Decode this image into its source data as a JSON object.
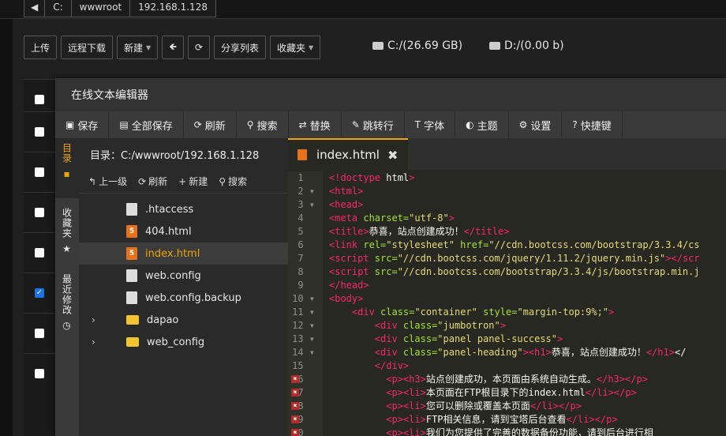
{
  "breadcrumb": [
    "C:",
    "wwwroot",
    "192.168.1.128"
  ],
  "toolbar": {
    "upload": "上传",
    "remote_download": "远程下载",
    "new": "新建",
    "share_list": "分享列表",
    "favorites": "收藏夹"
  },
  "disks": [
    {
      "label": "C:/(26.69 GB)"
    },
    {
      "label": "D:/(0.00 b)"
    }
  ],
  "editor": {
    "title": "在线文本编辑器",
    "tools": [
      "保存",
      "全部保存",
      "刷新",
      "搜索",
      "替换",
      "跳转行",
      "字体",
      "主题",
      "设置",
      "快捷键"
    ],
    "side_tabs": [
      "目录",
      "收藏夹",
      "最近修改"
    ],
    "directory_label": "目录：C:/wwwroot/192.168.1.128",
    "tree_tools": [
      "上一级",
      "刷新",
      "新建",
      "搜索"
    ],
    "files": [
      {
        "name": ".htaccess",
        "type": "doc"
      },
      {
        "name": "404.html",
        "type": "html"
      },
      {
        "name": "index.html",
        "type": "html",
        "selected": true
      },
      {
        "name": "web.config",
        "type": "doc"
      },
      {
        "name": "web.config.backup",
        "type": "doc"
      },
      {
        "name": "dapao",
        "type": "folder"
      },
      {
        "name": "web_config",
        "type": "folder"
      }
    ],
    "active_tab": "index.html",
    "line_numbers": [
      "1",
      "2",
      "3",
      "4",
      "5",
      "6",
      "7",
      "8",
      "9",
      "10",
      "11",
      "12",
      "13",
      "14",
      "15",
      "16",
      "17",
      "18",
      "19",
      "20"
    ],
    "code_lines": [
      "<!doctype html>",
      "<html>",
      "<head>",
      "<meta charset=\"utf-8\">",
      "<title>恭喜，站点创建成功！</title>",
      "<link rel=\"stylesheet\" href=\"//cdn.bootcss.com/bootstrap/3.3.4/cs",
      "<script src=\"//cdn.bootcss.com/jquery/1.11.2/jquery.min.js\"></scr",
      "<script src=\"//cdn.bootcss.com/bootstrap/3.3.4/js/bootstrap.min.j",
      "</head>",
      "<body>",
      "    <div class=\"container\" style=\"margin-top:9%;\">",
      "        <div class=\"jumbotron\">",
      "        <div class=\"panel panel-success\">",
      "        <div class=\"panel-heading\"><h1>恭喜，站点创建成功！</h1></",
      "        </div>",
      "          <p><h3>站点创建成功，本页面由系统自动生成。</h3></p>",
      "          <p><li>本页面在FTP根目录下的index.html</li></p>",
      "          <p><li>您可以删除或覆盖本页面</li></p>",
      "          <p><li>FTP相关信息，请到宝塔后台查看</li></p>",
      "          <p><li>我们为您提供了完善的数据备份功能，请到后台进行相"
    ]
  }
}
